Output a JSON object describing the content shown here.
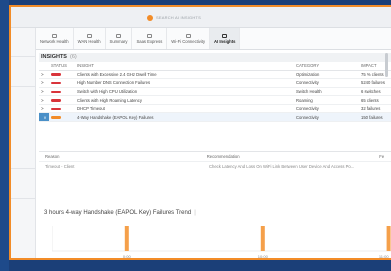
{
  "search": {
    "placeholder": "SEARCH AI INSIGHTS"
  },
  "tabs": [
    {
      "label": "Network Health",
      "active": false
    },
    {
      "label": "WAN Health",
      "active": false
    },
    {
      "label": "Summary",
      "active": false
    },
    {
      "label": "Saas Express",
      "active": false
    },
    {
      "label": "Wi-Fi Connectivity",
      "active": false
    },
    {
      "label": "AI Insights",
      "active": true
    }
  ],
  "insights": {
    "title": "INSIGHTS",
    "count": "(6)",
    "columns": [
      "STATUS",
      "INSIGHT",
      "CATEGORY",
      "IMPACT"
    ],
    "rows": [
      {
        "insight": "Clients with Excessive 2.4 GHz Dwell Time",
        "category": "Optimization",
        "impact": "75 % clients",
        "status": "red"
      },
      {
        "insight": "High Number DNS Connection Failures",
        "category": "Connectivity",
        "impact": "5240 failures",
        "status": "red"
      },
      {
        "insight": "Switch with High CPU Utilization",
        "category": "Switch Health",
        "impact": "6 switches",
        "status": "red"
      },
      {
        "insight": "Clients with High Roaming Latency",
        "category": "Roaming",
        "impact": "65 clients",
        "status": "red"
      },
      {
        "insight": "DHCP Timeout",
        "category": "Connectivity",
        "impact": "32 failures",
        "status": "red"
      },
      {
        "insight": "4-Way Handshake (EAPOL Key) Failures",
        "category": "Connectivity",
        "impact": "150 failures",
        "status": "orange",
        "selected": true
      }
    ]
  },
  "details": {
    "columns": {
      "reason": "Reason",
      "recommendation": "Recommendation",
      "feedback": "Fe"
    },
    "row": {
      "reason": "Timeout - Client",
      "recommendation": "Check Latency And Loss On WiFi Link Between User Device And Access Po..."
    }
  },
  "trend": {
    "title": "3 hours 4-way Handshake (EAPOL Key) Failures Trend",
    "separator": "|"
  },
  "chart_data": {
    "type": "bar",
    "title": "3 hours 4-way Handshake (EAPOL Key) Failures Trend",
    "x_ticks": [
      "0:00",
      "10:00",
      "11:00"
    ],
    "bars": [
      {
        "x_pos": 0.22,
        "value": 1.0
      },
      {
        "x_pos": 0.62,
        "value": 1.0
      },
      {
        "x_pos": 0.99,
        "value": 1.0
      }
    ],
    "xlabel": "",
    "ylabel": "",
    "grid": true,
    "colors": {
      "bar": "#f5a04a",
      "axis": "#dddddd"
    }
  },
  "colors": {
    "accent": "#f28c28",
    "critical": "#d9343b",
    "selected_row": "#4a90c8",
    "frame": "#1b3f78"
  }
}
